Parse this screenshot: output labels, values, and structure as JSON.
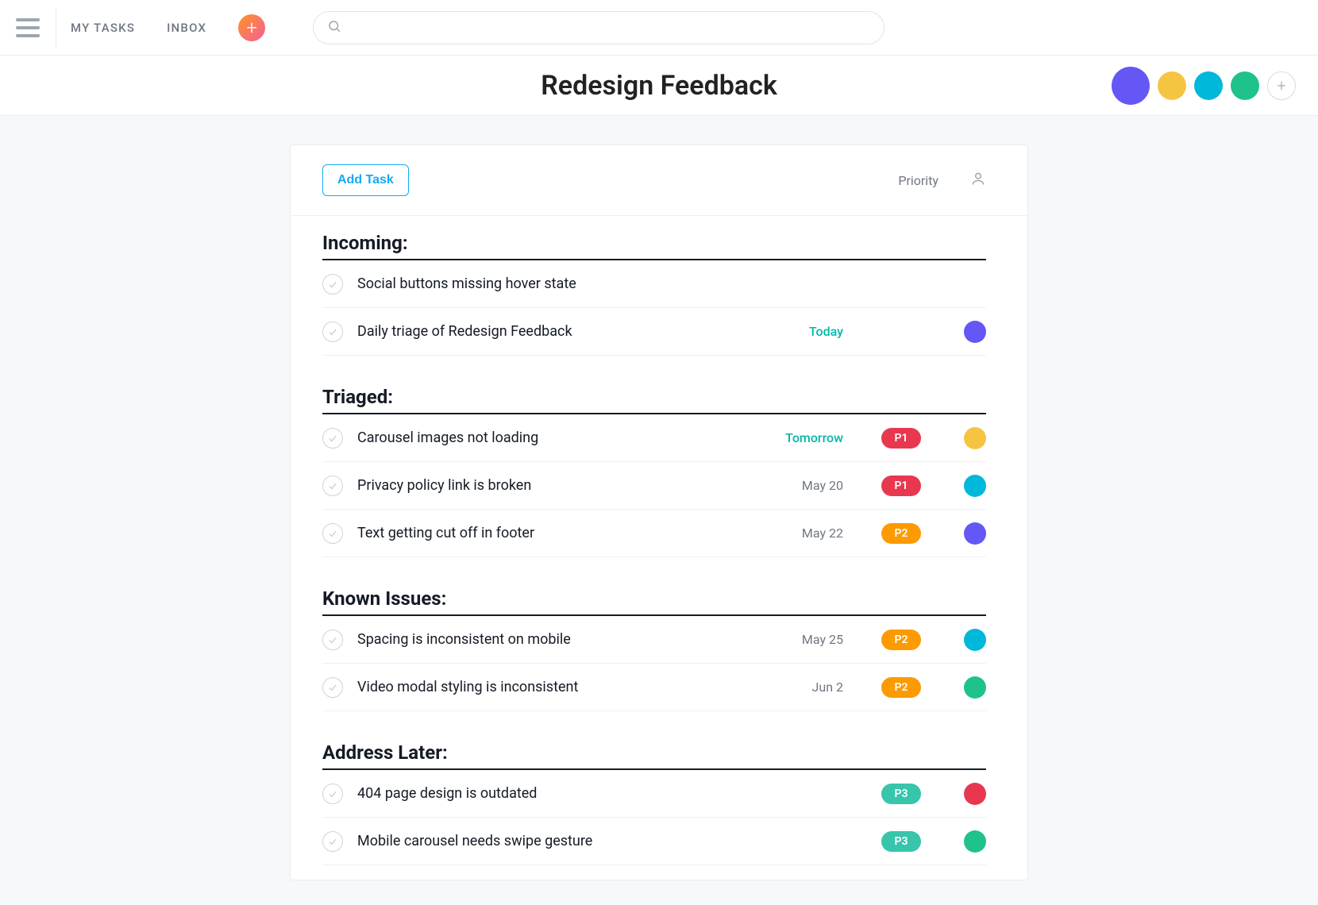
{
  "nav": {
    "my_tasks": "MY TASKS",
    "inbox": "INBOX"
  },
  "search": {
    "placeholder": ""
  },
  "page": {
    "title": "Redesign Feedback"
  },
  "header_avatars": [
    {
      "color": "#6457f5"
    },
    {
      "color": "#f5c542"
    },
    {
      "color": "#00b8d9"
    },
    {
      "color": "#1fc28b"
    }
  ],
  "panel": {
    "add_task_label": "Add Task",
    "priority_label": "Priority"
  },
  "priority_colors": {
    "P1": "#e8384f",
    "P2": "#fd9a00",
    "P3": "#37c5ab"
  },
  "avatar_colors": {
    "purple": "#6457f5",
    "yellow": "#f5c542",
    "teal": "#00b8d9",
    "green": "#1fc28b",
    "red": "#e8384f"
  },
  "sections": [
    {
      "title": "Incoming:",
      "tasks": [
        {
          "name": "Social buttons missing hover state",
          "date": "",
          "date_teal": false,
          "priority": "",
          "avatar": ""
        },
        {
          "name": "Daily triage of Redesign Feedback",
          "date": "Today",
          "date_teal": true,
          "priority": "",
          "avatar": "purple"
        }
      ]
    },
    {
      "title": "Triaged:",
      "tasks": [
        {
          "name": "Carousel images not loading",
          "date": "Tomorrow",
          "date_teal": true,
          "priority": "P1",
          "avatar": "yellow"
        },
        {
          "name": "Privacy policy link is broken",
          "date": "May 20",
          "date_teal": false,
          "priority": "P1",
          "avatar": "teal"
        },
        {
          "name": "Text getting cut off in footer",
          "date": "May 22",
          "date_teal": false,
          "priority": "P2",
          "avatar": "purple"
        }
      ]
    },
    {
      "title": "Known Issues:",
      "tasks": [
        {
          "name": "Spacing is inconsistent on mobile",
          "date": "May 25",
          "date_teal": false,
          "priority": "P2",
          "avatar": "teal"
        },
        {
          "name": "Video modal styling is inconsistent",
          "date": "Jun 2",
          "date_teal": false,
          "priority": "P2",
          "avatar": "green"
        }
      ]
    },
    {
      "title": "Address Later:",
      "tasks": [
        {
          "name": "404 page design is outdated",
          "date": "",
          "date_teal": false,
          "priority": "P3",
          "avatar": "red"
        },
        {
          "name": "Mobile carousel needs swipe gesture",
          "date": "",
          "date_teal": false,
          "priority": "P3",
          "avatar": "green"
        }
      ]
    }
  ]
}
